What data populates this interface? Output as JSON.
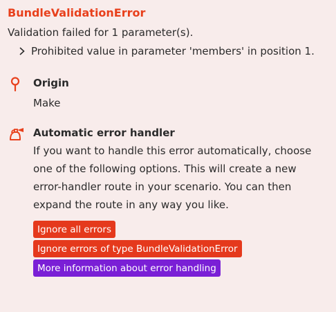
{
  "error": {
    "title": "BundleValidationError",
    "message": "Validation failed for 1 parameter(s).",
    "detail": "Prohibited value in parameter 'members' in position 1."
  },
  "origin": {
    "heading": "Origin",
    "value": "Make",
    "icon": "pin-icon"
  },
  "handler": {
    "heading": "Automatic error handler",
    "description": "If you want to handle this error automatically, choose one of the following options. This will create a new error-handler route in your scenario. You can then expand the route in any way you like.",
    "icon": "fire-extinguisher-icon",
    "buttons": {
      "ignore_all": "Ignore all errors",
      "ignore_type": "Ignore errors of type BundleValidationError",
      "more_info": "More information about error handling"
    }
  },
  "colors": {
    "accent_red": "#e8401c",
    "button_red": "#e5391c",
    "button_purple": "#7a1fd6",
    "background": "#f8eceb"
  }
}
